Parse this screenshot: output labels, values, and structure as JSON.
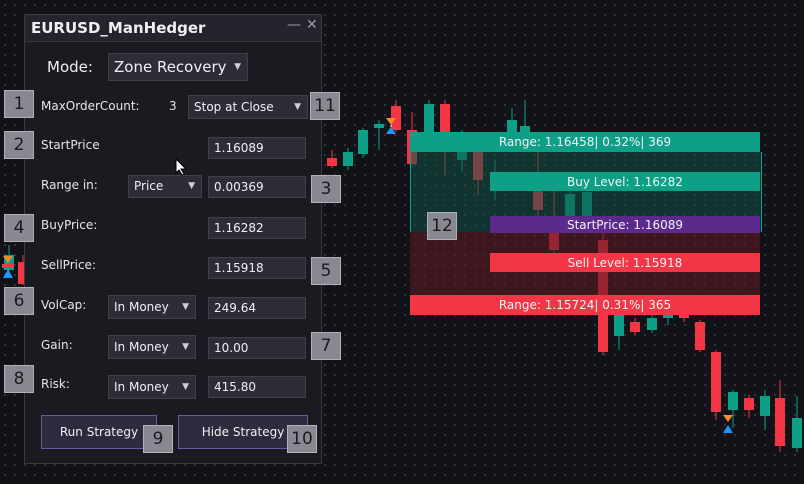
{
  "window": {
    "title": "EURUSD_ManHedger",
    "minimize_glyph": "—",
    "close_glyph": "✕"
  },
  "mode": {
    "label": "Mode:",
    "value": "Zone Recovery"
  },
  "max_order": {
    "label": "MaxOrderCount:",
    "value": "3",
    "mode_value": "Stop at Close"
  },
  "start_price": {
    "label": "StartPrice",
    "value": "1.16089"
  },
  "range": {
    "label": "Range in:",
    "unit_value": "Price",
    "value": "0.00369"
  },
  "buy_price": {
    "label": "BuyPrice:",
    "value": "1.16282"
  },
  "sell_price": {
    "label": "SellPrice:",
    "value": "1.15918"
  },
  "volcap": {
    "label": "VolCap:",
    "mode_value": "In Money",
    "value": "249.64"
  },
  "gain": {
    "label": "Gain:",
    "mode_value": "In Money",
    "value": "10.00"
  },
  "risk": {
    "label": "Risk:",
    "mode_value": "In Money",
    "value": "415.80"
  },
  "buttons": {
    "run": "Run Strategy",
    "hide": "Hide Strategy"
  },
  "badges": [
    "1",
    "2",
    "3",
    "4",
    "5",
    "6",
    "7",
    "8",
    "9",
    "10",
    "11",
    "12"
  ],
  "zones": {
    "range_high": "Range: 1.16458| 0.32%| 369",
    "buy_level": "Buy Level: 1.16282",
    "start_price": "StartPrice: 1.16089",
    "sell_level": "Sell Level: 1.15918",
    "range_low": "Range: 1.15724| 0.31%| 365"
  },
  "colors": {
    "bull": "#0e9f87",
    "bear": "#f23645",
    "start": "#5b2a8c",
    "zone_up": "#123f38",
    "zone_down": "#3c1a22"
  },
  "icons": [
    "caret-down-icon",
    "cursor-arrow-icon",
    "trade-arrow-icon"
  ]
}
